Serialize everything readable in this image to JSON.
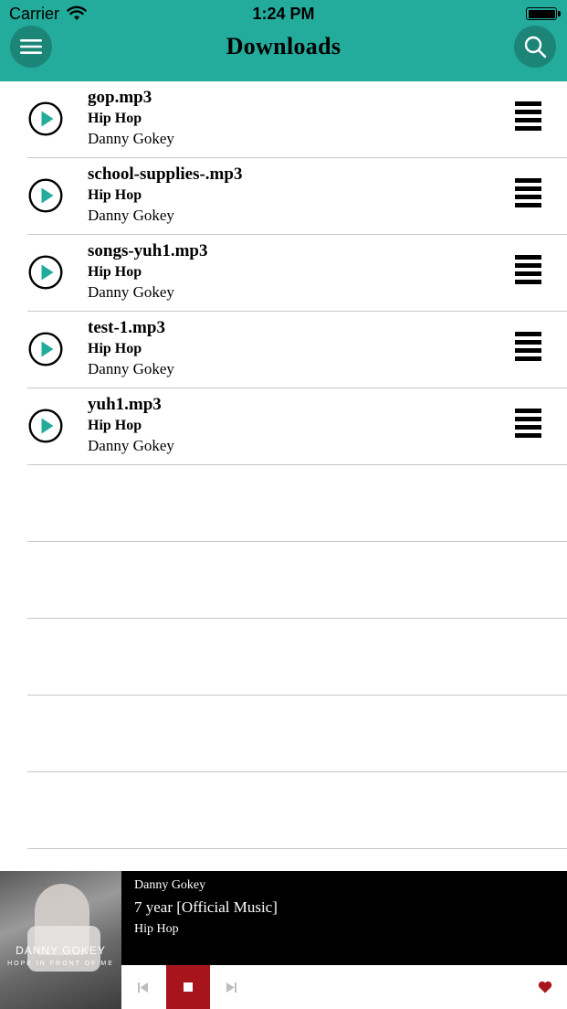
{
  "status_bar": {
    "carrier": "Carrier",
    "time": "1:24 PM"
  },
  "header": {
    "title": "Downloads"
  },
  "downloads": [
    {
      "file": "gop.mp3",
      "genre": "Hip Hop",
      "artist": "Danny Gokey"
    },
    {
      "file": "school-supplies-.mp3",
      "genre": "Hip Hop",
      "artist": "Danny Gokey"
    },
    {
      "file": "songs-yuh1.mp3",
      "genre": "Hip Hop",
      "artist": "Danny Gokey"
    },
    {
      "file": "test-1.mp3",
      "genre": "Hip Hop",
      "artist": "Danny Gokey"
    },
    {
      "file": "yuh1.mp3",
      "genre": "Hip Hop",
      "artist": "Danny Gokey"
    }
  ],
  "now_playing": {
    "artist": "Danny Gokey",
    "title": "7 year [Official Music]",
    "genre": "Hip Hop",
    "cover_text": "DANNY GOKEY",
    "cover_subtext": "HOPE IN FRONT OF ME"
  },
  "colors": {
    "accent": "#23ab9c",
    "header_button": "#1b8578",
    "stop_button": "#a8141b"
  },
  "icons": [
    "menu-icon",
    "search-icon",
    "play-circle-icon",
    "drag-handle-icon",
    "previous-icon",
    "stop-icon",
    "next-icon",
    "heart-icon"
  ]
}
